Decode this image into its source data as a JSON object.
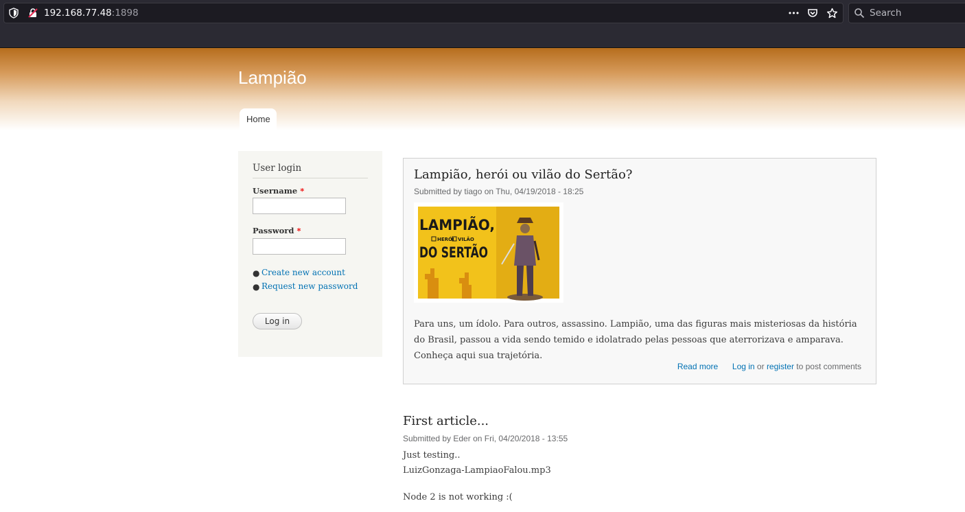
{
  "browser": {
    "url_host": "192.168.77.48",
    "url_port": ":1898",
    "search_placeholder": "Search",
    "more_glyph": "•••"
  },
  "site": {
    "name": "Lampião",
    "nav": {
      "home_label": "Home"
    }
  },
  "sidebar": {
    "block_title": "User login",
    "username_label": "Username",
    "password_label": "Password",
    "required_marker": "*",
    "links": [
      "Create new account",
      "Request new password"
    ],
    "login_button": "Log in"
  },
  "articles": [
    {
      "title": "Lampião, herói ou vilão do Sertão?",
      "meta_prefix": "Submitted by ",
      "author": "tiago",
      "meta_on": " on ",
      "date": "Thu, 04/19/2018 - 18:25",
      "image_text": {
        "line1": "LAMPIÃO,",
        "opt1": "HERÓI",
        "opt2": "VILÃO",
        "line2": "DO SERTÃO"
      },
      "body": "Para uns, um ídolo. Para outros, assassino. Lampião, uma das figuras mais misteriosas da história do Brasil, passou a vida sendo temido e idolatrado pelas pessoas que aterrorizava e amparava. Conheça aqui sua trajetória.",
      "read_more": "Read more",
      "login_link": "Log in",
      "or_text": " or ",
      "register_link": "register",
      "comment_suffix": " to post comments"
    },
    {
      "title": "First article...",
      "meta_prefix": "Submitted by ",
      "author": "Eder",
      "meta_on": " on ",
      "date": "Fri, 04/20/2018 - 13:55",
      "lines": [
        "Just testing..",
        "LuizGonzaga-LampiaoFalou.mp3",
        "Node 2 is not working :("
      ]
    }
  ],
  "colors": {
    "header_top": "#b66d1d",
    "link": "#0071b3",
    "sidebar_bg": "#f6f6f2",
    "image_yellow": "#f2c21b"
  }
}
